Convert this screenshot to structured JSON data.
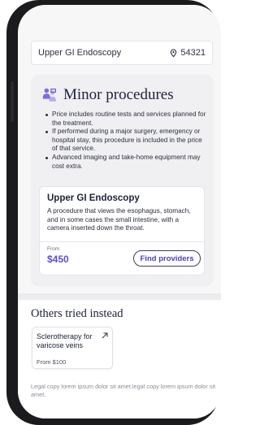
{
  "search": {
    "procedure": "Upper GI Endoscopy",
    "zip": "54321"
  },
  "procedures": {
    "title": "Minor procedures",
    "bullets": [
      "Price includes routine tests and services planned for the treatment.",
      "If performed during a major surgery, emergency or hospital stay, this procedure is included in the price of that service.",
      "Advanced imaging and take-home equipment may cost extra."
    ],
    "card": {
      "title": "Upper GI Endoscopy",
      "description": "A procedure that views the esophagus, stomach, and in some cases the small intestine, with a camera inserted down the throat.",
      "from_label": "From",
      "price": "$450",
      "button_label": "Find providers"
    }
  },
  "others": {
    "title": "Others tried instead",
    "items": [
      {
        "name": "Sclerotherapy for varicose veins",
        "price": "From $100"
      }
    ]
  },
  "legal": "Legal copy lorem ipsum dolor sit amet.legal copy lorem ipsum dolor sit amet.",
  "colors": {
    "accent": "#5a4fcf",
    "button_text": "#4a3fc0",
    "title": "#20243a",
    "card_bg": "#f0f0f3"
  },
  "icons": {
    "location": "map-pin-icon",
    "procedure": "people-icon",
    "external": "arrow-up-right-icon"
  }
}
